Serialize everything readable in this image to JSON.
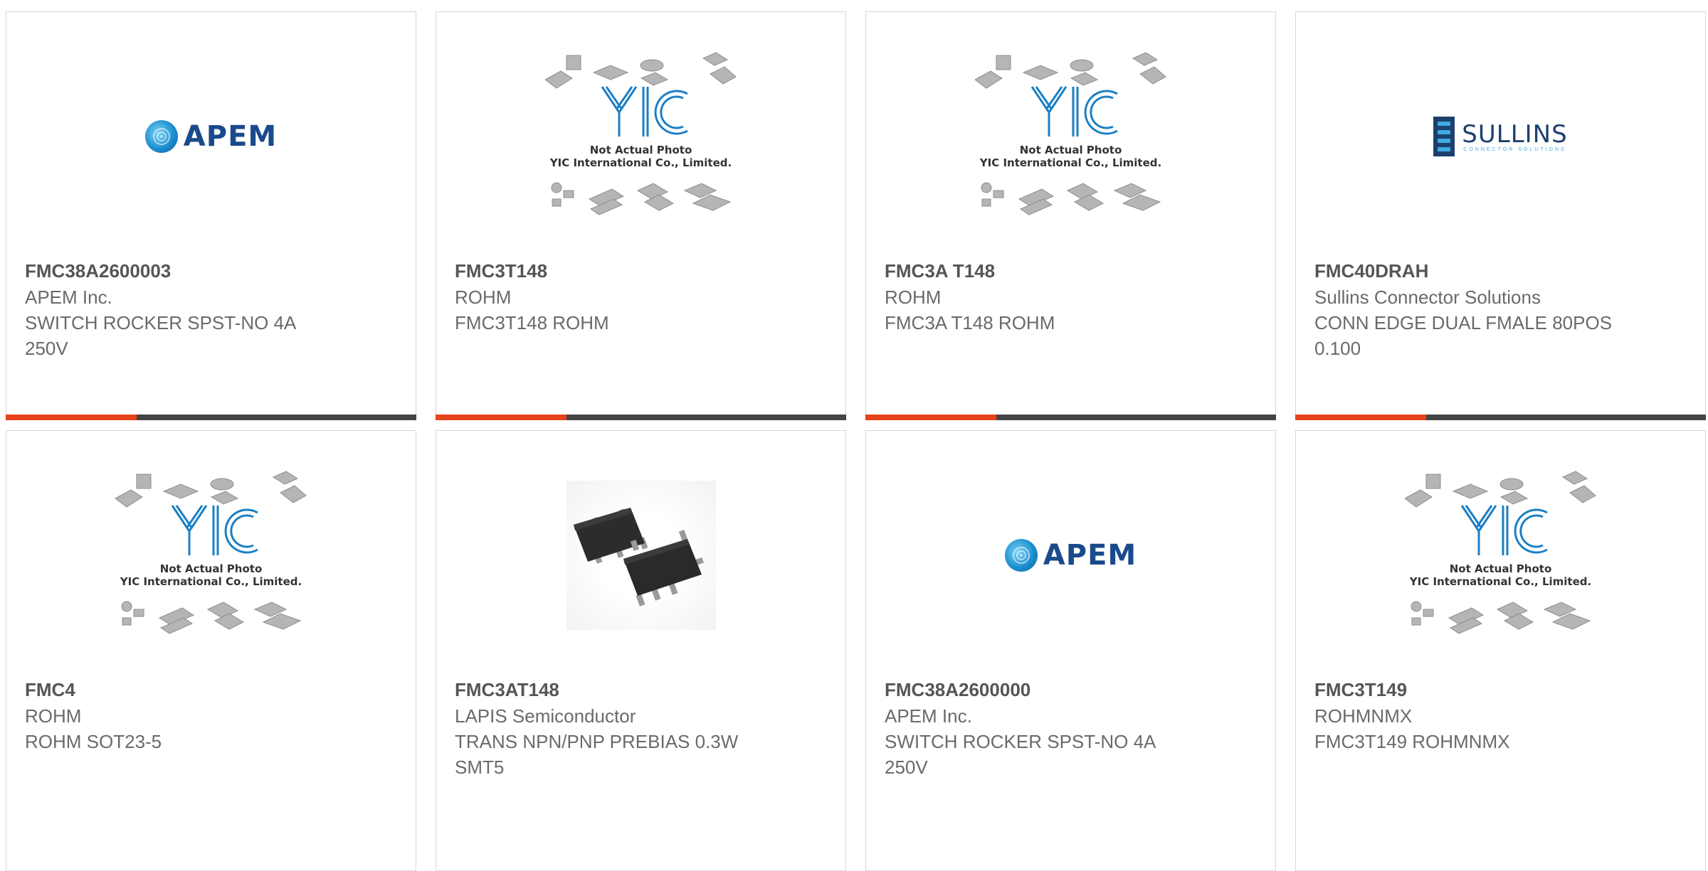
{
  "products": [
    {
      "part_number": "FMC38A2600003",
      "manufacturer": "APEM Inc.",
      "description": "SWITCH ROCKER SPST-NO 4A 250V",
      "image": "apem-logo",
      "logo_text": "APEM"
    },
    {
      "part_number": "FMC3T148",
      "manufacturer": "ROHM",
      "description": "FMC3T148 ROHM",
      "image": "yic-placeholder",
      "placeholder_line1": "Not Actual Photo",
      "placeholder_line2": "YIC International Co., Limited."
    },
    {
      "part_number": "FMC3A T148",
      "manufacturer": "ROHM",
      "description": "FMC3A T148 ROHM",
      "image": "yic-placeholder",
      "placeholder_line1": "Not Actual Photo",
      "placeholder_line2": "YIC International Co., Limited."
    },
    {
      "part_number": "FMC40DRAH",
      "manufacturer": "Sullins Connector Solutions",
      "description": "CONN EDGE DUAL FMALE 80POS 0.100",
      "image": "sullins-logo",
      "logo_text": "SULLINS",
      "logo_tagline": "CONNECTOR SOLUTIONS"
    },
    {
      "part_number": "FMC4",
      "manufacturer": "ROHM",
      "description": "ROHM SOT23-5",
      "image": "yic-placeholder",
      "placeholder_line1": "Not Actual Photo",
      "placeholder_line2": "YIC International Co., Limited."
    },
    {
      "part_number": "FMC3AT148",
      "manufacturer": "LAPIS Semiconductor",
      "description": "TRANS NPN/PNP PREBIAS 0.3W SMT5",
      "image": "sot23-5-photo"
    },
    {
      "part_number": "FMC38A2600000",
      "manufacturer": "APEM Inc.",
      "description": "SWITCH ROCKER SPST-NO 4A 250V",
      "image": "apem-logo",
      "logo_text": "APEM"
    },
    {
      "part_number": "FMC3T149",
      "manufacturer": "ROHMNMX",
      "description": "FMC3T149 ROHMNMX",
      "image": "yic-placeholder",
      "placeholder_line1": "Not Actual Photo",
      "placeholder_line2": "YIC International Co., Limited."
    }
  ],
  "colors": {
    "accent": "#e8421a",
    "bar": "#444444",
    "text_strong": "#555555",
    "text": "#6a6a6a",
    "apem_blue": "#1a4a8c",
    "yic_blue": "#1c7fc4",
    "sullins_navy": "#1d3f6e"
  }
}
